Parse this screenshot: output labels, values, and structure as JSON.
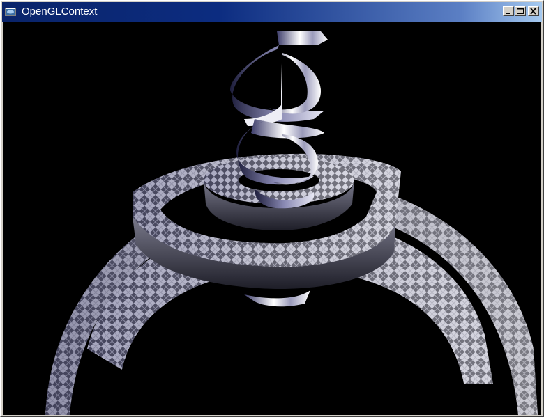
{
  "window": {
    "title": "OpenGLContext",
    "controls": {
      "minimize": "minimize",
      "maximize": "maximize",
      "close": "close"
    }
  },
  "scene": {
    "background": "#000000",
    "objects": [
      "twisted-helix-ribbon",
      "stacked-spiral-rings"
    ],
    "ring_texture": "checker-diamond",
    "colors": {
      "ring_light": "#c9c9d6",
      "ring_dark": "#2a2a3a",
      "ribbon_light": "#ffffff",
      "ribbon_shade": "#4a4a78"
    }
  }
}
